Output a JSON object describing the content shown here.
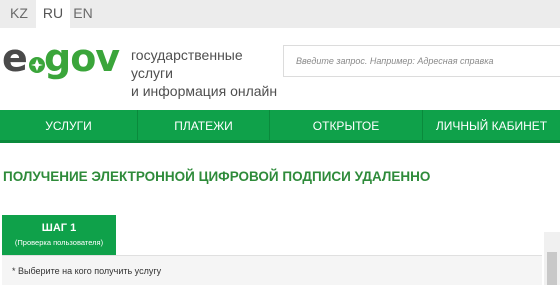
{
  "languages": [
    {
      "code": "KZ",
      "active": false
    },
    {
      "code": "RU",
      "active": true
    },
    {
      "code": "EN",
      "active": false
    }
  ],
  "logo": {
    "part1": "e",
    "part2": "gov"
  },
  "tagline": {
    "line1": "государственные услуги",
    "line2": "и информация онлайн"
  },
  "search": {
    "placeholder": "Введите запрос. Например: Адресная справка"
  },
  "nav": {
    "items": [
      "УСЛУГИ",
      "ПЛАТЕЖИ",
      "ОТКРЫТОЕ ПРАВИТЕЛЬСТВО",
      "ЛИЧНЫЙ КАБИНЕТ"
    ]
  },
  "page": {
    "title": "ПОЛУЧЕНИЕ ЭЛЕКТРОННОЙ ЦИФРОВОЙ ПОДПИСИ УДАЛЕННО"
  },
  "step": {
    "label": "ШАГ 1",
    "sub": "(Проверка пользователя)"
  },
  "form": {
    "hint": "* Выберите на кого получить услугу"
  },
  "colors": {
    "brand_green": "#0fa14a",
    "title_green": "#2e8b3a",
    "logo_gray": "#4a4a4a"
  },
  "icons": {
    "logo_emblem": "egov-emblem-icon"
  }
}
